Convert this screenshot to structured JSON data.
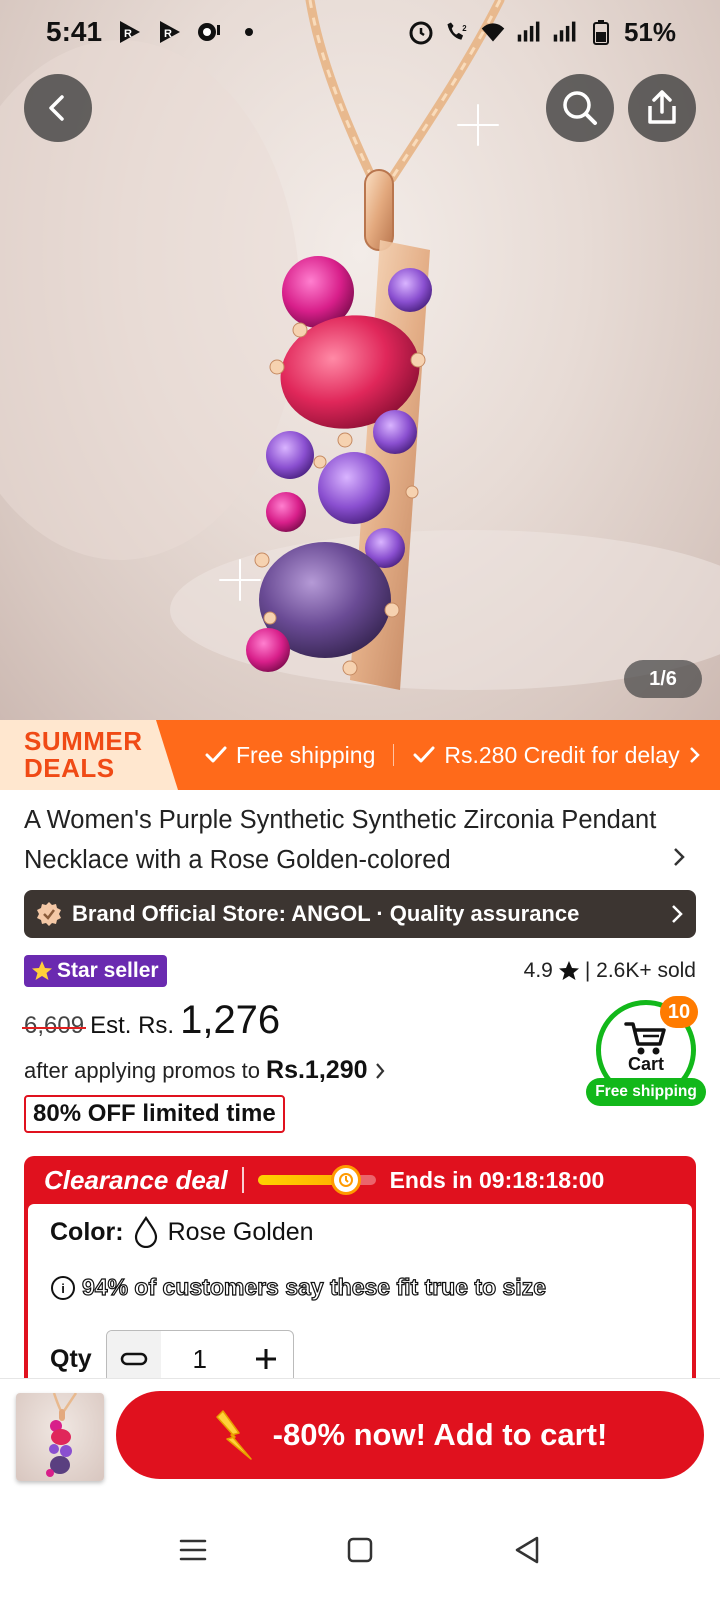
{
  "status_bar": {
    "time": "5:41",
    "battery": "51%",
    "icons": [
      "r-app-icon",
      "r-app-icon",
      "chat-icon",
      "dot-icon",
      "alarm-icon",
      "wifi-call-icon",
      "wifi-icon",
      "signal-icon",
      "signal-icon",
      "battery-icon"
    ]
  },
  "gallery": {
    "page_indicator": "1/6",
    "current_image": 1,
    "total_images": 6
  },
  "promo_banner": {
    "badge_line1": "SUMMER",
    "badge_line2": "DEALS",
    "perk1": "Free shipping",
    "perk2": "Rs.280 Credit for delay"
  },
  "product": {
    "title": "A Women's Purple Synthetic Synthetic Zirconia Pendant Necklace with a Rose Golden-colored",
    "store": "Brand Official Store: ANGOL · Quality assurance",
    "star_seller": "Star seller",
    "rating": "4.9",
    "sold": "| 2.6K+ sold",
    "original_price": "6,609",
    "est_label": "Est. Rs.",
    "est_price": "1,276",
    "promo_text": "after applying promos to",
    "promo_price": "Rs.1,290",
    "off_badge": "80% OFF limited time"
  },
  "cart": {
    "count": "10",
    "label": "Cart",
    "free_shipping": "Free shipping"
  },
  "clearance": {
    "title": "Clearance deal",
    "progress_fraction": 0.75,
    "ends_in": "Ends in 09:18:18:00",
    "color_label": "Color:",
    "color_value": "Rose Golden",
    "fit_text": "94% of customers say these fit true to size",
    "qty_label": "Qty",
    "qty_value": "1"
  },
  "bottom_bar": {
    "add_to_cart": "-80% now! Add to cart!"
  },
  "colors": {
    "brand_red": "#e0111e",
    "banner_orange": "#ff6a1a",
    "cart_green": "#12b81a",
    "star_seller_purple": "#6a2ab0"
  }
}
